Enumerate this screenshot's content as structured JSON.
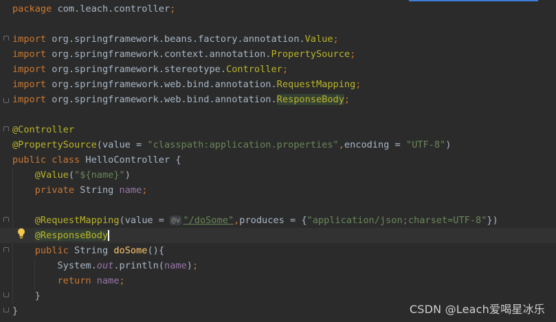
{
  "editor": {
    "lines": [
      {
        "segments": [
          [
            "kw",
            "package "
          ],
          [
            "pkg",
            "com.leach.controller"
          ],
          [
            "kw",
            ";"
          ]
        ]
      },
      {
        "segments": []
      },
      {
        "segments": [
          [
            "kw",
            "import "
          ],
          [
            "pkg",
            "org.springframework.beans.factory.annotation."
          ],
          [
            "cls",
            "Value"
          ],
          [
            "kw",
            ";"
          ]
        ]
      },
      {
        "segments": [
          [
            "kw",
            "import "
          ],
          [
            "pkg",
            "org.springframework.context.annotation."
          ],
          [
            "cls",
            "PropertySource"
          ],
          [
            "kw",
            ";"
          ]
        ]
      },
      {
        "segments": [
          [
            "kw",
            "import "
          ],
          [
            "pkg",
            "org.springframework.stereotype."
          ],
          [
            "cls",
            "Controller"
          ],
          [
            "kw",
            ";"
          ]
        ]
      },
      {
        "segments": [
          [
            "kw",
            "import "
          ],
          [
            "pkg",
            "org.springframework.web.bind.annotation."
          ],
          [
            "cls",
            "RequestMapping"
          ],
          [
            "kw",
            ";"
          ]
        ]
      },
      {
        "segments": [
          [
            "kw",
            "import "
          ],
          [
            "pkg",
            "org.springframework.web.bind.annotation."
          ],
          [
            "cls hl-usage",
            "ResponseBody"
          ],
          [
            "kw",
            ";"
          ]
        ]
      },
      {
        "segments": []
      },
      {
        "segments": [
          [
            "anno",
            "@Controller"
          ]
        ]
      },
      {
        "segments": [
          [
            "anno",
            "@PropertySource"
          ],
          [
            "pkg",
            "(value = "
          ],
          [
            "str",
            "\"classpath:application.properties\""
          ],
          [
            "kw",
            ","
          ],
          [
            "pkg",
            "encoding = "
          ],
          [
            "str",
            "\"UTF-8\""
          ],
          [
            "pkg",
            ")"
          ]
        ]
      },
      {
        "segments": [
          [
            "kw",
            "public class "
          ],
          [
            "pkg",
            "HelloController {"
          ]
        ]
      },
      {
        "segments": [
          [
            "pkg",
            "    "
          ],
          [
            "anno",
            "@Value"
          ],
          [
            "pkg",
            "("
          ],
          [
            "str",
            "\"${name}\""
          ],
          [
            "pkg",
            ")"
          ]
        ]
      },
      {
        "segments": [
          [
            "pkg",
            "    "
          ],
          [
            "kw",
            "private "
          ],
          [
            "pkg",
            "String "
          ],
          [
            "field",
            "name"
          ],
          [
            "kw",
            ";"
          ]
        ]
      },
      {
        "segments": []
      },
      {
        "segments": [
          [
            "pkg",
            "    "
          ],
          [
            "anno",
            "@RequestMapping"
          ],
          [
            "pkg",
            "(value = "
          ],
          [
            "inlay",
            "@v"
          ],
          [
            "str-link",
            "\"/doSome\""
          ],
          [
            "kw",
            ","
          ],
          [
            "pkg",
            "produces = {"
          ],
          [
            "str",
            "\"application/json;charset=UTF-8\""
          ],
          [
            "pkg",
            "})"
          ]
        ],
        "inlay_label": "@v"
      },
      {
        "segments": [
          [
            "pkg",
            "    "
          ],
          [
            "anno hl-cur",
            "@ResponseBody"
          ]
        ],
        "current": true
      },
      {
        "segments": [
          [
            "pkg",
            "    "
          ],
          [
            "kw",
            "public "
          ],
          [
            "pkg",
            "String "
          ],
          [
            "method",
            "doSome"
          ],
          [
            "pkg",
            "(){"
          ]
        ]
      },
      {
        "segments": [
          [
            "pkg",
            "        System."
          ],
          [
            "italic-field",
            "out"
          ],
          [
            "pkg",
            ".println("
          ],
          [
            "field",
            "name"
          ],
          [
            "pkg",
            ")"
          ],
          [
            "kw",
            ";"
          ]
        ]
      },
      {
        "segments": [
          [
            "pkg",
            "        "
          ],
          [
            "kw",
            "return "
          ],
          [
            "field",
            "name"
          ],
          [
            "kw",
            ";"
          ]
        ]
      },
      {
        "segments": [
          [
            "pkg",
            "    }"
          ]
        ]
      },
      {
        "segments": [
          [
            "pkg",
            "}"
          ]
        ]
      }
    ]
  },
  "watermark": "CSDN @Leach爱喝星冰乐",
  "icons": {
    "bulb": "lightbulb-intention-icon",
    "inlay": "endpoint-inlay-icon"
  },
  "colors": {
    "background": "#2b2b2b",
    "keyword": "#cc7832",
    "annotation": "#bbb529",
    "string": "#6a8759",
    "field": "#9876aa",
    "method": "#ffc66d",
    "text": "#a9b7c6"
  }
}
